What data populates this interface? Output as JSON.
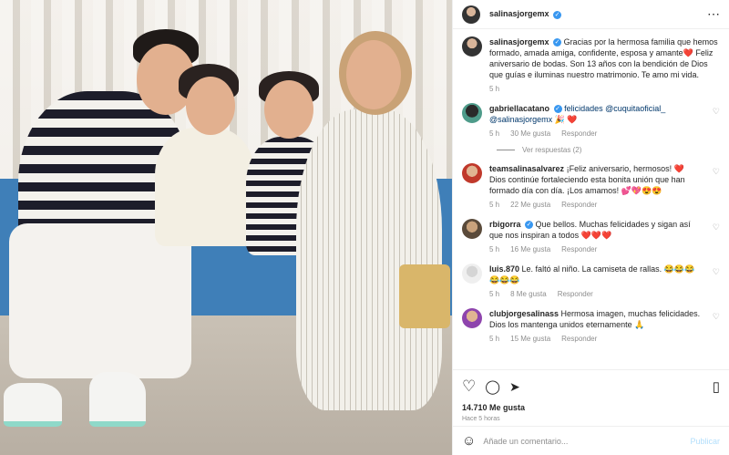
{
  "post": {
    "author": "salinasjorgemx",
    "caption": "Gracias por la hermosa familia que hemos formado, amada amiga, confidente, esposa y amante❤️ Feliz aniversario de bodas. Son 13 años con la bendición de Dios que guías e iluminas nuestro matrimonio. Te amo mi vida.",
    "caption_time": "5 h",
    "likes": "14.710 Me gusta",
    "posted_ago": "Hace 5 horas"
  },
  "comments": [
    {
      "user": "gabriellacatano",
      "text": "felicidades @cuquitaoficial_ @salinasjorgemx 🎉 ❤️",
      "time": "5 h",
      "likes": "30 Me gusta",
      "reply": "Responder",
      "view_replies": "Ver respuestas (2)"
    },
    {
      "user": "teamsalinasalvarez",
      "text": "¡Feliz aniversario, hermosos! ❤️ Dios continúe fortaleciendo esta bonita unión que han formado día con día. ¡Los amamos! 💕💖😍😍",
      "time": "5 h",
      "likes": "22 Me gusta",
      "reply": "Responder"
    },
    {
      "user": "rbigorra",
      "text": "Que bellos. Muchas felicidades y sigan así que nos inspiran a todos ❤️❤️❤️",
      "time": "5 h",
      "likes": "16 Me gusta",
      "reply": "Responder"
    },
    {
      "user": "luis.870",
      "text": "Le. faltó al niño. La camiseta de rallas. 😂😂😂😂😂😂",
      "time": "5 h",
      "likes": "8 Me gusta",
      "reply": "Responder"
    },
    {
      "user": "clubjorgesalinass",
      "text": "Hermosa imagen, muchas felicidades. Dios los mantenga unidos eternamente 🙏",
      "time": "5 h",
      "likes": "15 Me gusta",
      "reply": "Responder"
    }
  ],
  "composer": {
    "placeholder": "Añade un comentario...",
    "publish": "Publicar"
  },
  "icons": {
    "more": "⋯",
    "heart": "♡",
    "comment": "◯",
    "share": "➤",
    "save": "▯",
    "emoji": "☺"
  }
}
